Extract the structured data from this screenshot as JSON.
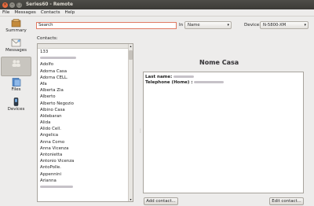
{
  "window": {
    "title": "Series60 - Remote"
  },
  "menu": [
    "File",
    "Messages",
    "Contacts",
    "Help"
  ],
  "sidebar": [
    {
      "label": "Summary",
      "icon": "summary-icon"
    },
    {
      "label": "Messages",
      "icon": "messages-icon"
    },
    {
      "label": "",
      "icon": "contacts-icon"
    },
    {
      "label": "Files",
      "icon": "files-icon"
    },
    {
      "label": "Devices",
      "icon": "devices-icon"
    }
  ],
  "search": {
    "value": "Search"
  },
  "filter": {
    "in_label": "In",
    "field": "Name"
  },
  "device": {
    "label": "Device:",
    "value": "N-5800-XM"
  },
  "contacts": {
    "label": "Contacts:",
    "items": [
      "133",
      "",
      "Adolfo",
      "Adorna Casa",
      "Adorna CELL.",
      "Afa",
      "Alberta Zia",
      "Alberto",
      "Alberto Negozio",
      "Albino Casa",
      "Aldebaran",
      "Alida",
      "Alido Cell.",
      "Angelica",
      "Anna Como",
      "Anna Vicenza",
      "Antonietta",
      "Antonio Vicenza",
      "AntoPolle.",
      "Appennini",
      "Arianna",
      ""
    ]
  },
  "detail": {
    "title": "Nome Casa",
    "last_name_label": "Last name:",
    "telephone_label": "Telephone (Home) :"
  },
  "buttons": {
    "add": "Add contact...",
    "edit": "Edit contact..."
  }
}
